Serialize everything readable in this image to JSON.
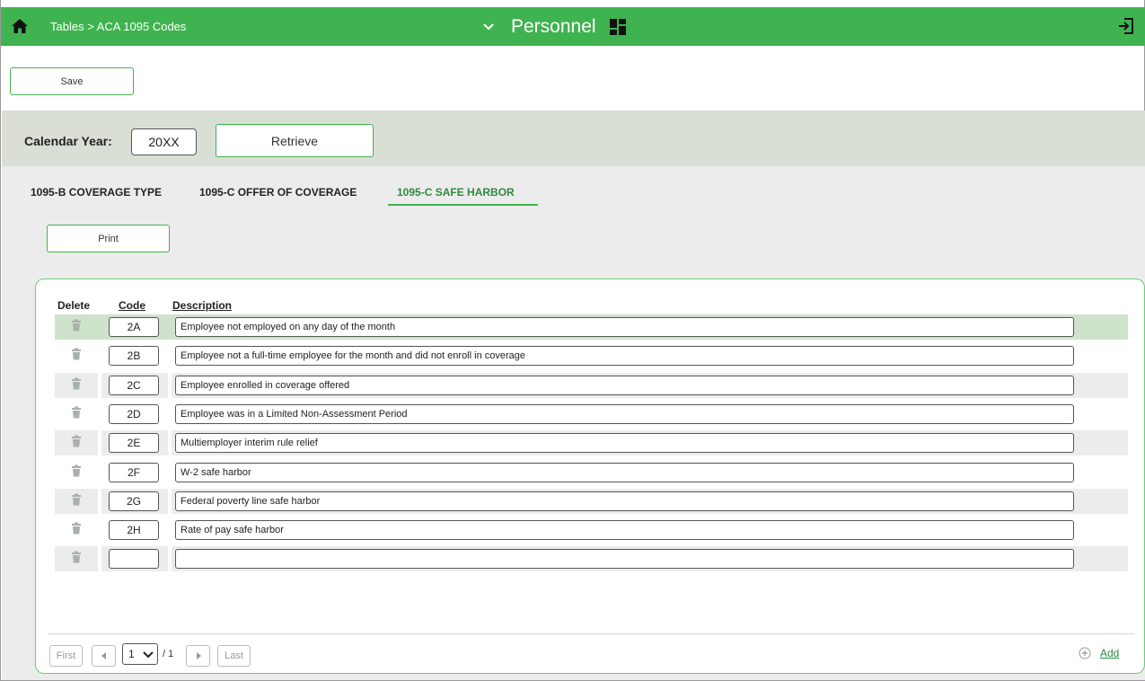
{
  "header": {
    "breadcrumb": "Tables > ACA 1095 Codes",
    "app_title": "Personnel",
    "icons": [
      "home-icon",
      "chevron-down-icon",
      "grid-icon",
      "logout-icon"
    ]
  },
  "toolbar": {
    "save_label": "Save"
  },
  "filter": {
    "year_label": "Calendar Year:",
    "year_value": "20XX",
    "retrieve_label": "Retrieve"
  },
  "tabs": [
    {
      "label": "1095-B COVERAGE TYPE",
      "active": false
    },
    {
      "label": "1095-C OFFER OF COVERAGE",
      "active": false
    },
    {
      "label": "1095-C SAFE HARBOR",
      "active": true
    }
  ],
  "print_label": "Print",
  "table": {
    "columns": [
      "Delete",
      "Code",
      "Description"
    ],
    "rows": [
      {
        "code": "2A",
        "description": "Employee not employed on any day of the month"
      },
      {
        "code": "2B",
        "description": "Employee not a full-time employee for the month and did not enroll in coverage"
      },
      {
        "code": "2C",
        "description": "Employee enrolled in coverage offered"
      },
      {
        "code": "2D",
        "description": "Employee was in a Limited Non-Assessment Period"
      },
      {
        "code": "2E",
        "description": "Multiemployer interim rule relief"
      },
      {
        "code": "2F",
        "description": "W-2 safe harbor"
      },
      {
        "code": "2G",
        "description": "Federal poverty line safe harbor"
      },
      {
        "code": "2H",
        "description": "Rate of pay safe harbor"
      },
      {
        "code": "",
        "description": ""
      }
    ],
    "selected_row": 0
  },
  "pager": {
    "first_label": "First",
    "last_label": "Last",
    "page": "1",
    "total": "/ 1",
    "add_label": "Add"
  },
  "colors": {
    "accent": "#3fb34f",
    "selected_row": "#cfe3cc",
    "band": "#d9dfd5"
  }
}
